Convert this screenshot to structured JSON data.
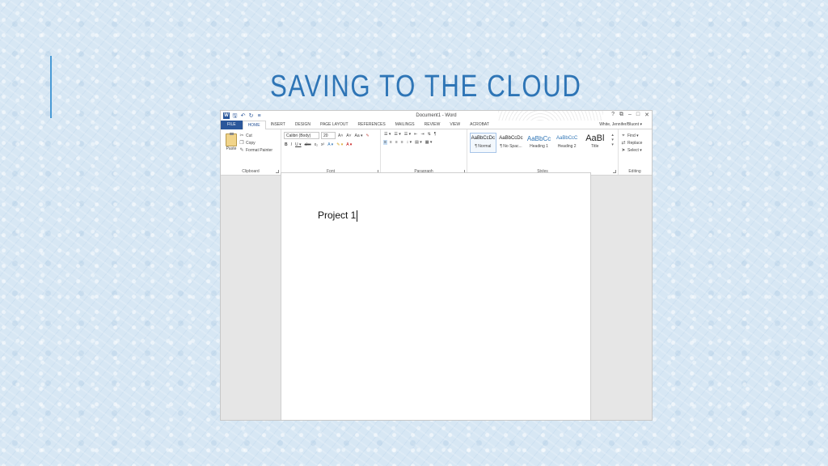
{
  "slide": {
    "title": "SAVING TO THE CLOUD"
  },
  "word": {
    "window_title": "Document1 - Word",
    "user": "White, Jennifer/Bluont ▾",
    "window_controls": [
      "?",
      "⧉",
      "–",
      "□",
      "✕"
    ],
    "tabs": [
      "FILE",
      "HOME",
      "INSERT",
      "DESIGN",
      "PAGE LAYOUT",
      "REFERENCES",
      "MAILINGS",
      "REVIEW",
      "VIEW",
      "ACROBAT"
    ],
    "active_tab": "HOME",
    "clipboard": {
      "paste": "Paste",
      "cut": "Cut",
      "copy": "Copy",
      "format_painter": "Format Painter",
      "label": "Clipboard"
    },
    "font": {
      "family": "Calibri (Body)",
      "size": "20",
      "label": "Font",
      "row1": [
        "A˄",
        "A˅",
        "Aa ▾",
        "✎"
      ],
      "row2": [
        "B",
        "I",
        "U ▾",
        "abc",
        "x₂",
        "x²",
        "A ▾",
        "✎ ▾",
        "A ▾"
      ]
    },
    "paragraph": {
      "label": "Paragraph",
      "row1": [
        "☰ ▾",
        "☰ ▾",
        "☰ ▾",
        "⇤",
        "⇥",
        "⇅",
        "¶"
      ],
      "row2": [
        "≡",
        "≡",
        "≡",
        "≡",
        "↕ ▾",
        "▤ ▾",
        "▦ ▾"
      ]
    },
    "styles": {
      "label": "Styles",
      "items": [
        {
          "preview": "AaBbCcDc",
          "name": "¶ Normal"
        },
        {
          "preview": "AaBbCcDc",
          "name": "¶ No Spac..."
        },
        {
          "preview": "AaBbCc",
          "name": "Heading 1"
        },
        {
          "preview": "AaBbCcC",
          "name": "Heading 2"
        },
        {
          "preview": "AaBl",
          "name": "Title"
        }
      ]
    },
    "editing": {
      "label": "Editing",
      "find": "Find ▾",
      "replace": "Replace",
      "select": "Select ▾"
    },
    "document": {
      "text": "Project 1"
    }
  },
  "colors": {
    "title": "#2e75b6",
    "word_blue": "#2b579a",
    "accent_bar": "#4a9bd6"
  }
}
